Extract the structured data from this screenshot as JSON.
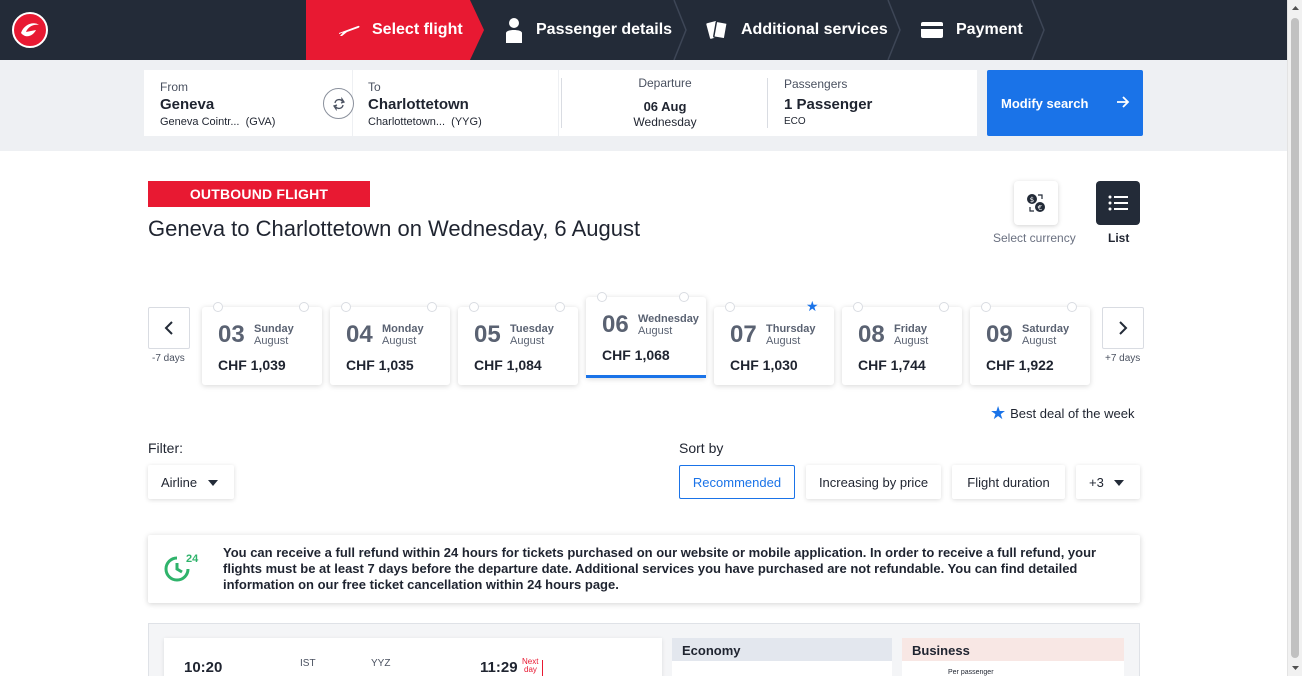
{
  "brand": {
    "primary": "#e81932",
    "navy": "#232b38",
    "accent": "#1a73e8"
  },
  "steps": [
    {
      "label": "Select flight",
      "icon": "plane-icon",
      "active": true
    },
    {
      "label": "Passenger details",
      "icon": "person-icon",
      "active": false
    },
    {
      "label": "Additional services",
      "icon": "cards-icon",
      "active": false
    },
    {
      "label": "Payment",
      "icon": "card-icon",
      "active": false
    }
  ],
  "search": {
    "from_label": "From",
    "from_city": "Geneva",
    "from_airport": "Geneva Cointr...",
    "from_code": "(GVA)",
    "to_label": "To",
    "to_city": "Charlottetown",
    "to_airport": "Charlottetown...",
    "to_code": "(YYG)",
    "departure_label": "Departure",
    "departure_date": "06 Aug",
    "departure_day": "Wednesday",
    "passengers_label": "Passengers",
    "passengers_value": "1 Passenger",
    "cabin": "ECO",
    "modify_label": "Modify search"
  },
  "outbound": {
    "tag": "OUTBOUND FLIGHT",
    "title": "Geneva to Charlottetown on Wednesday, 6 August",
    "currency_label": "Select currency",
    "list_label": "List"
  },
  "dates": {
    "prev_label": "-7 days",
    "next_label": "+7 days",
    "days": [
      {
        "num": "03",
        "name": "Sunday",
        "month": "August",
        "price": "CHF 1,039",
        "active": false,
        "best": false
      },
      {
        "num": "04",
        "name": "Monday",
        "month": "August",
        "price": "CHF 1,035",
        "active": false,
        "best": false
      },
      {
        "num": "05",
        "name": "Tuesday",
        "month": "August",
        "price": "CHF 1,084",
        "active": false,
        "best": false
      },
      {
        "num": "06",
        "name": "Wednesday",
        "month": "August",
        "price": "CHF 1,068",
        "active": true,
        "best": false
      },
      {
        "num": "07",
        "name": "Thursday",
        "month": "August",
        "price": "CHF 1,030",
        "active": false,
        "best": true
      },
      {
        "num": "08",
        "name": "Friday",
        "month": "August",
        "price": "CHF 1,744",
        "active": false,
        "best": false
      },
      {
        "num": "09",
        "name": "Saturday",
        "month": "August",
        "price": "CHF 1,922",
        "active": false,
        "best": false
      }
    ],
    "best_deal_label": "Best deal of the week"
  },
  "filter": {
    "label": "Filter:",
    "airline_label": "Airline"
  },
  "sort": {
    "label": "Sort by",
    "options": [
      "Recommended",
      "Increasing by price",
      "Flight duration",
      "+3"
    ],
    "selected": "Recommended"
  },
  "refund": {
    "badge": "24",
    "text": "You can receive a full refund within 24 hours for tickets purchased on our website or mobile application. In order to receive a full refund, your flights must be at least 7 days before the departure date. Additional services you have purchased are not refundable. You can find detailed information on our free ticket cancellation within 24 hours page."
  },
  "result": {
    "depart_time": "10:20",
    "via_code": "IST",
    "arrive_code": "YYZ",
    "arrive_time": "11:29",
    "next_day_1": "Next",
    "next_day_2": "day",
    "economy_label": "Economy",
    "business_label": "Business",
    "per_passenger": "Per passenger"
  }
}
